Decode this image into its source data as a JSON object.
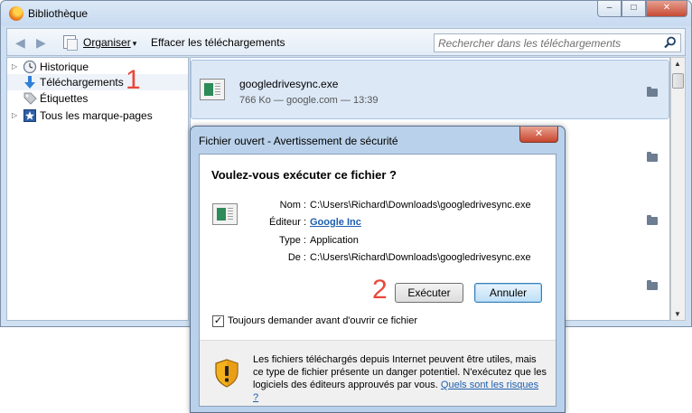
{
  "library": {
    "title": "Bibliothèque",
    "caption_buttons": {
      "minimize": "–",
      "maximize": "□",
      "close": "✕"
    },
    "toolbar": {
      "back_icon": "back-arrow-icon",
      "forward_icon": "forward-arrow-icon",
      "organize_label": "Organiser",
      "organize_caret": "▾",
      "clear_downloads_label": "Effacer les téléchargements",
      "search_placeholder": "Rechercher dans les téléchargements"
    },
    "sidebar": {
      "items": [
        {
          "label": "Historique",
          "icon": "clock-icon",
          "expandable": true
        },
        {
          "label": "Téléchargements",
          "icon": "download-arrow-icon",
          "expandable": false,
          "selected": true
        },
        {
          "label": "Étiquettes",
          "icon": "tag-icon",
          "expandable": false
        },
        {
          "label": "Tous les marque-pages",
          "icon": "bookmarks-star-icon",
          "expandable": true
        }
      ],
      "expand_glyph": "▷"
    },
    "downloads": [
      {
        "name": "googledrivesync.exe",
        "meta": "766 Ko — google.com — 13:39"
      }
    ]
  },
  "annotations": {
    "step1": "1",
    "step2": "2"
  },
  "dialog": {
    "title": "Fichier ouvert - Avertissement de sécurité",
    "close_glyph": "✕",
    "question": "Voulez-vous exécuter ce fichier ?",
    "fields": {
      "name_label": "Nom :",
      "name_value": "C:\\Users\\Richard\\Downloads\\googledrivesync.exe",
      "publisher_label": "Éditeur :",
      "publisher_value": "Google Inc",
      "type_label": "Type :",
      "type_value": "Application",
      "from_label": "De :",
      "from_value": "C:\\Users\\Richard\\Downloads\\googledrivesync.exe"
    },
    "run_button": "Exécuter",
    "cancel_button": "Annuler",
    "checkbox_label": "Toujours demander avant d'ouvrir ce fichier",
    "checkbox_checked": true,
    "checkmark": "✓",
    "footer_text": "Les fichiers téléchargés depuis Internet peuvent être utiles, mais ce type de fichier présente un danger potentiel. N'exécutez que les logiciels des éditeurs approuvés par vous.",
    "footer_link": "Quels sont les risques ?"
  }
}
